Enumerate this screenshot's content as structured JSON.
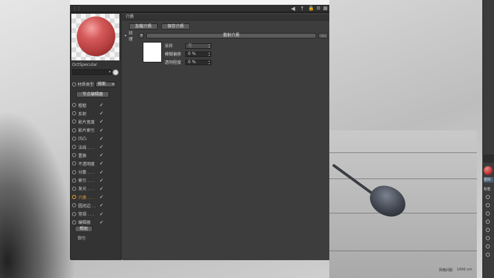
{
  "app": {
    "material_name": "OctSpecular"
  },
  "toolbar_icons": [
    "arrow-left-icon",
    "arrow-up-icon",
    "lock-icon",
    "grid-icon"
  ],
  "left_panel": {
    "type_label": "材质类型",
    "type_value": "镜面",
    "node_editor_label": "节点编辑器",
    "channels": [
      {
        "label": "粗糙",
        "checked": true,
        "active": false
      },
      {
        "label": "反射",
        "checked": true,
        "active": false
      },
      {
        "label": "影片宽度",
        "checked": true,
        "active": false
      },
      {
        "label": "影片索引",
        "checked": true,
        "active": false
      },
      {
        "label": "凹凸",
        "checked": true,
        "active": false
      },
      {
        "label": "法线 . . .",
        "checked": true,
        "active": false
      },
      {
        "label": "置换",
        "checked": true,
        "active": false
      },
      {
        "label": "不透明度",
        "checked": true,
        "active": false
      },
      {
        "label": "分散 . . .",
        "checked": true,
        "active": false
      },
      {
        "label": "索引 . . .",
        "checked": true,
        "active": false
      },
      {
        "label": "发光 . . .",
        "checked": true,
        "active": false
      },
      {
        "label": "介质 . . .",
        "checked": true,
        "active": true
      },
      {
        "label": "圆润边 . .",
        "checked": true,
        "active": false
      },
      {
        "label": "常规 . . .",
        "checked": true,
        "active": false
      },
      {
        "label": "编辑器",
        "checked": true,
        "active": false
      }
    ],
    "check_mark": "✓",
    "help_label": "帮助",
    "guide_label": "指引"
  },
  "content": {
    "section_title": "介质",
    "load_button": "加载介质",
    "save_button": "保存介质",
    "texture_label": "纹理",
    "texture_plus": "+",
    "texture_value": "散射介质",
    "texture_more": "...",
    "params": [
      {
        "label": "采样",
        "value": "无",
        "disabled": true
      },
      {
        "label": "模糊偏移",
        "value": "0 %",
        "disabled": false
      },
      {
        "label": "透明程度",
        "value": "0 %",
        "disabled": false
      }
    ],
    "swatch_color": "#ffffff"
  },
  "right_strip": {
    "label1": "基础",
    "label2": "标签"
  },
  "status": {
    "grid_label": "网格间距",
    "grid_value": "1000 cm"
  }
}
